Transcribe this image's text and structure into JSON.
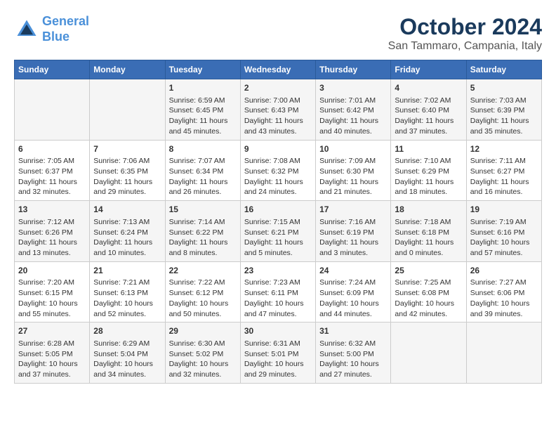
{
  "header": {
    "logo_line1": "General",
    "logo_line2": "Blue",
    "month": "October 2024",
    "location": "San Tammaro, Campania, Italy"
  },
  "days_of_week": [
    "Sunday",
    "Monday",
    "Tuesday",
    "Wednesday",
    "Thursday",
    "Friday",
    "Saturday"
  ],
  "weeks": [
    [
      {
        "day": "",
        "info": ""
      },
      {
        "day": "",
        "info": ""
      },
      {
        "day": "1",
        "info": "Sunrise: 6:59 AM\nSunset: 6:45 PM\nDaylight: 11 hours and 45 minutes."
      },
      {
        "day": "2",
        "info": "Sunrise: 7:00 AM\nSunset: 6:43 PM\nDaylight: 11 hours and 43 minutes."
      },
      {
        "day": "3",
        "info": "Sunrise: 7:01 AM\nSunset: 6:42 PM\nDaylight: 11 hours and 40 minutes."
      },
      {
        "day": "4",
        "info": "Sunrise: 7:02 AM\nSunset: 6:40 PM\nDaylight: 11 hours and 37 minutes."
      },
      {
        "day": "5",
        "info": "Sunrise: 7:03 AM\nSunset: 6:39 PM\nDaylight: 11 hours and 35 minutes."
      }
    ],
    [
      {
        "day": "6",
        "info": "Sunrise: 7:05 AM\nSunset: 6:37 PM\nDaylight: 11 hours and 32 minutes."
      },
      {
        "day": "7",
        "info": "Sunrise: 7:06 AM\nSunset: 6:35 PM\nDaylight: 11 hours and 29 minutes."
      },
      {
        "day": "8",
        "info": "Sunrise: 7:07 AM\nSunset: 6:34 PM\nDaylight: 11 hours and 26 minutes."
      },
      {
        "day": "9",
        "info": "Sunrise: 7:08 AM\nSunset: 6:32 PM\nDaylight: 11 hours and 24 minutes."
      },
      {
        "day": "10",
        "info": "Sunrise: 7:09 AM\nSunset: 6:30 PM\nDaylight: 11 hours and 21 minutes."
      },
      {
        "day": "11",
        "info": "Sunrise: 7:10 AM\nSunset: 6:29 PM\nDaylight: 11 hours and 18 minutes."
      },
      {
        "day": "12",
        "info": "Sunrise: 7:11 AM\nSunset: 6:27 PM\nDaylight: 11 hours and 16 minutes."
      }
    ],
    [
      {
        "day": "13",
        "info": "Sunrise: 7:12 AM\nSunset: 6:26 PM\nDaylight: 11 hours and 13 minutes."
      },
      {
        "day": "14",
        "info": "Sunrise: 7:13 AM\nSunset: 6:24 PM\nDaylight: 11 hours and 10 minutes."
      },
      {
        "day": "15",
        "info": "Sunrise: 7:14 AM\nSunset: 6:22 PM\nDaylight: 11 hours and 8 minutes."
      },
      {
        "day": "16",
        "info": "Sunrise: 7:15 AM\nSunset: 6:21 PM\nDaylight: 11 hours and 5 minutes."
      },
      {
        "day": "17",
        "info": "Sunrise: 7:16 AM\nSunset: 6:19 PM\nDaylight: 11 hours and 3 minutes."
      },
      {
        "day": "18",
        "info": "Sunrise: 7:18 AM\nSunset: 6:18 PM\nDaylight: 11 hours and 0 minutes."
      },
      {
        "day": "19",
        "info": "Sunrise: 7:19 AM\nSunset: 6:16 PM\nDaylight: 10 hours and 57 minutes."
      }
    ],
    [
      {
        "day": "20",
        "info": "Sunrise: 7:20 AM\nSunset: 6:15 PM\nDaylight: 10 hours and 55 minutes."
      },
      {
        "day": "21",
        "info": "Sunrise: 7:21 AM\nSunset: 6:13 PM\nDaylight: 10 hours and 52 minutes."
      },
      {
        "day": "22",
        "info": "Sunrise: 7:22 AM\nSunset: 6:12 PM\nDaylight: 10 hours and 50 minutes."
      },
      {
        "day": "23",
        "info": "Sunrise: 7:23 AM\nSunset: 6:11 PM\nDaylight: 10 hours and 47 minutes."
      },
      {
        "day": "24",
        "info": "Sunrise: 7:24 AM\nSunset: 6:09 PM\nDaylight: 10 hours and 44 minutes."
      },
      {
        "day": "25",
        "info": "Sunrise: 7:25 AM\nSunset: 6:08 PM\nDaylight: 10 hours and 42 minutes."
      },
      {
        "day": "26",
        "info": "Sunrise: 7:27 AM\nSunset: 6:06 PM\nDaylight: 10 hours and 39 minutes."
      }
    ],
    [
      {
        "day": "27",
        "info": "Sunrise: 6:28 AM\nSunset: 5:05 PM\nDaylight: 10 hours and 37 minutes."
      },
      {
        "day": "28",
        "info": "Sunrise: 6:29 AM\nSunset: 5:04 PM\nDaylight: 10 hours and 34 minutes."
      },
      {
        "day": "29",
        "info": "Sunrise: 6:30 AM\nSunset: 5:02 PM\nDaylight: 10 hours and 32 minutes."
      },
      {
        "day": "30",
        "info": "Sunrise: 6:31 AM\nSunset: 5:01 PM\nDaylight: 10 hours and 29 minutes."
      },
      {
        "day": "31",
        "info": "Sunrise: 6:32 AM\nSunset: 5:00 PM\nDaylight: 10 hours and 27 minutes."
      },
      {
        "day": "",
        "info": ""
      },
      {
        "day": "",
        "info": ""
      }
    ]
  ]
}
